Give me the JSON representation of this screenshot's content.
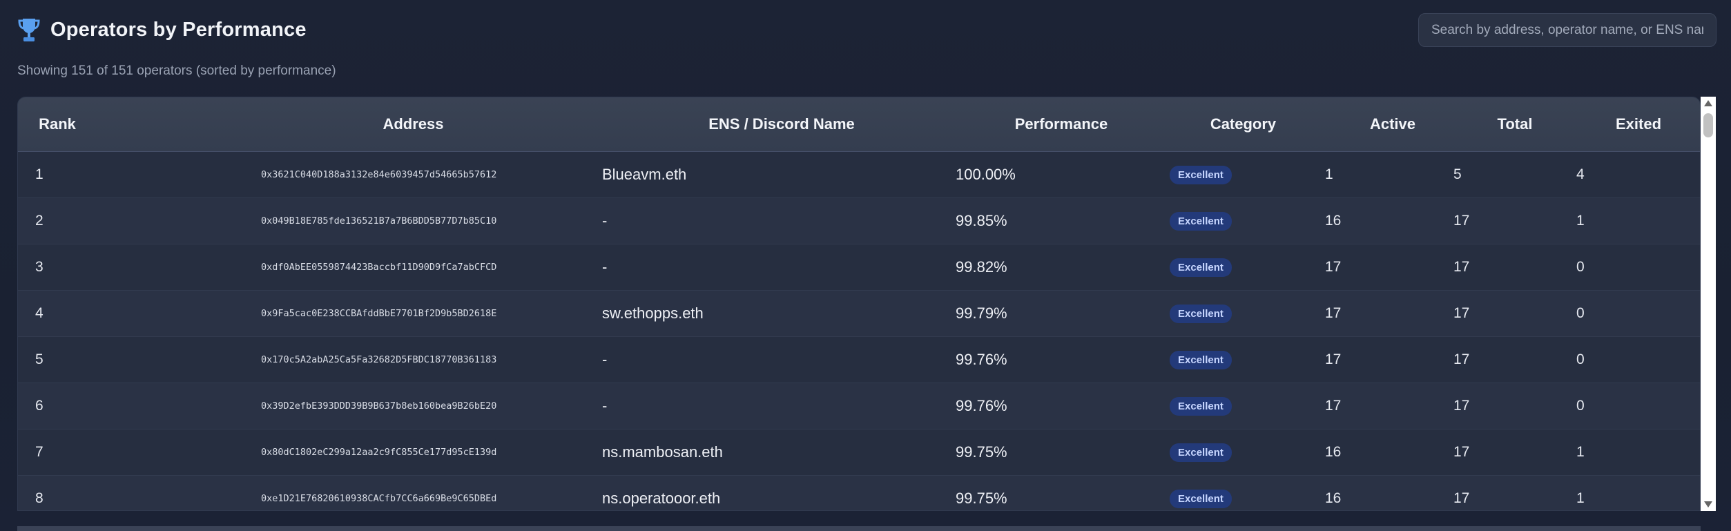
{
  "header": {
    "icon": "trophy-icon",
    "title": "Operators by Performance",
    "summary": "Showing 151 of 151 operators (sorted by performance)"
  },
  "search": {
    "placeholder": "Search by address, operator name, or ENS nar",
    "value": ""
  },
  "colors": {
    "background": "#1c2335",
    "badge_bg": "#233a7a",
    "badge_text": "#c7d6ff",
    "trophy": "#5aa0f0"
  },
  "table": {
    "columns": [
      "Rank",
      "Address",
      "ENS / Discord Name",
      "Performance",
      "Category",
      "Active",
      "Total",
      "Exited"
    ],
    "rows": [
      {
        "rank": "1",
        "address": "0x3621C040D188a3132e84e6039457d54665b57612",
        "ens": "Blueavm.eth",
        "performance": "100.00%",
        "category": "Excellent",
        "active": "1",
        "total": "5",
        "exited": "4"
      },
      {
        "rank": "2",
        "address": "0x049B18E785fde136521B7a7B6BDD5B77D7b85C10",
        "ens": "-",
        "performance": "99.85%",
        "category": "Excellent",
        "active": "16",
        "total": "17",
        "exited": "1"
      },
      {
        "rank": "3",
        "address": "0xdf0AbEE0559874423Baccbf11D90D9fCa7abCFCD",
        "ens": "-",
        "performance": "99.82%",
        "category": "Excellent",
        "active": "17",
        "total": "17",
        "exited": "0"
      },
      {
        "rank": "4",
        "address": "0x9Fa5cac0E238CCBAfddBbE7701Bf2D9b5BD2618E",
        "ens": "sw.ethopps.eth",
        "performance": "99.79%",
        "category": "Excellent",
        "active": "17",
        "total": "17",
        "exited": "0"
      },
      {
        "rank": "5",
        "address": "0x170c5A2abA25Ca5Fa32682D5FBDC18770B361183",
        "ens": "-",
        "performance": "99.76%",
        "category": "Excellent",
        "active": "17",
        "total": "17",
        "exited": "0"
      },
      {
        "rank": "6",
        "address": "0x39D2efbE393DDD39B9B637b8eb160bea9B26bE20",
        "ens": "-",
        "performance": "99.76%",
        "category": "Excellent",
        "active": "17",
        "total": "17",
        "exited": "0"
      },
      {
        "rank": "7",
        "address": "0x80dC1802eC299a12aa2c9fC855Ce177d95cE139d",
        "ens": "ns.mambosan.eth",
        "performance": "99.75%",
        "category": "Excellent",
        "active": "16",
        "total": "17",
        "exited": "1"
      },
      {
        "rank": "8",
        "address": "0xe1D21E76820610938CACfb7CC6a669Be9C65DBEd",
        "ens": "ns.operatooor.eth",
        "performance": "99.75%",
        "category": "Excellent",
        "active": "16",
        "total": "17",
        "exited": "1"
      }
    ]
  }
}
